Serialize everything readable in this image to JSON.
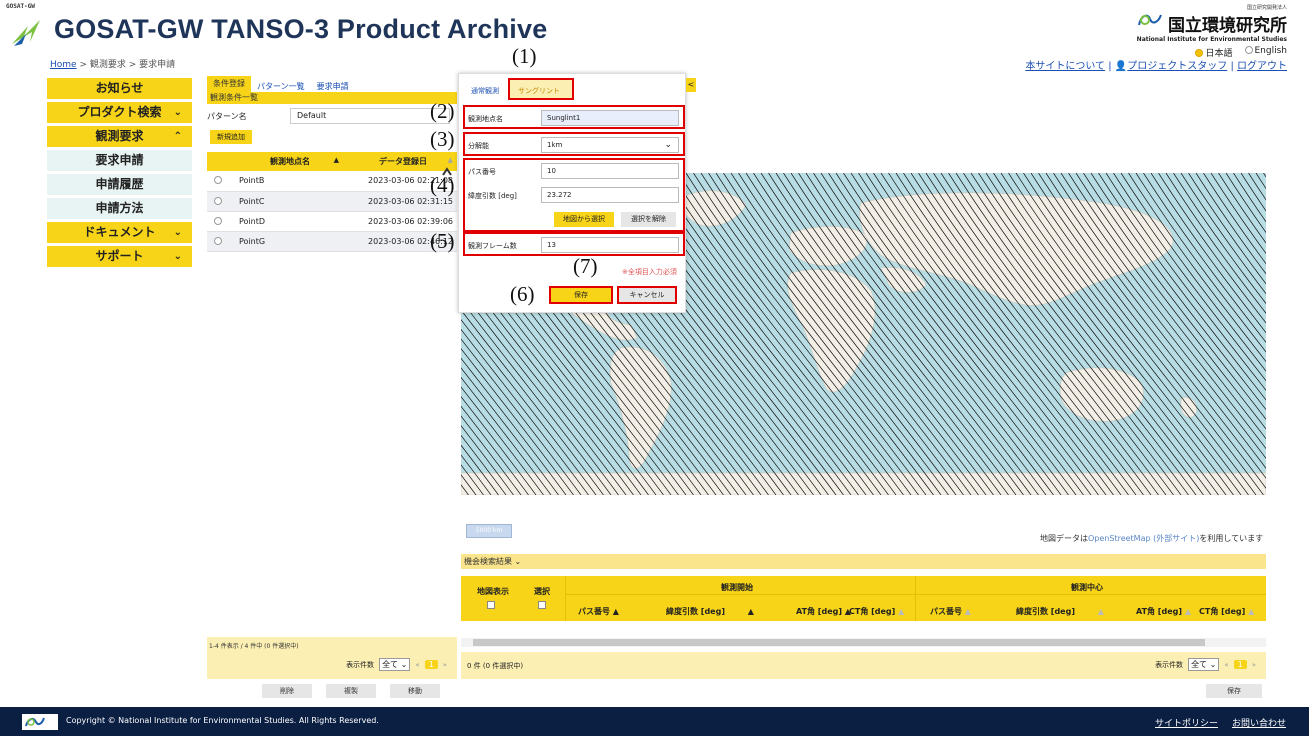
{
  "header": {
    "gw_tag": "GOSAT-GW",
    "title": "GOSAT-GW TANSO-3 Product Archive",
    "breadcrumb": {
      "home": "Home",
      "sep1": " > ",
      "middle": "観測要求",
      "sep2": " > ",
      "current": "要求申請"
    },
    "institute": {
      "small": "国立研究開発法人",
      "name_jp": "国立環境研究所",
      "name_en": "National Institute for Environmental Studies"
    },
    "languages": [
      {
        "label": "日本語",
        "selected": true
      },
      {
        "label": "English",
        "selected": false
      }
    ],
    "links": {
      "about": "本サイトについて",
      "sep1": "|",
      "staff": "プロジェクトスタッフ",
      "sep2": "|",
      "logout": "ログアウト"
    }
  },
  "nav": {
    "items": [
      {
        "label": "お知らせ",
        "chevron": ""
      },
      {
        "label": "プロダクト検索",
        "chevron": "⌄"
      },
      {
        "label": "観測要求",
        "chevron": "⌃"
      }
    ],
    "subitems": [
      "要求申請",
      "申請履歴",
      "申請方法"
    ],
    "items2": [
      {
        "label": "ドキュメント",
        "chevron": "⌄"
      },
      {
        "label": "サポート",
        "chevron": "⌄"
      }
    ]
  },
  "left_panel": {
    "tabs": [
      "条件登録",
      "パターン一覧",
      "要求申請"
    ],
    "section_title": "観測条件一覧",
    "pattern_label": "パターン名",
    "pattern_value": "Default",
    "new_button": "新規追加",
    "columns": [
      "観測地点名",
      "データ登録日"
    ],
    "rows": [
      {
        "name": "PointB",
        "date": "2023-03-06 02:21:08"
      },
      {
        "name": "PointC",
        "date": "2023-03-06 02:31:15"
      },
      {
        "name": "PointD",
        "date": "2023-03-06 02:39:06"
      },
      {
        "name": "PointG",
        "date": "2023-03-06 02:46:12"
      }
    ],
    "count_text": "1-4 件表示 / 4 件中 (0 件選択中)",
    "per_page_label": "表示件数",
    "per_page_value": "全て ⌄",
    "page": "1",
    "buttons": [
      "削除",
      "複製",
      "移動"
    ]
  },
  "dialog": {
    "tabs": [
      "通常観測",
      "サングリント"
    ],
    "site_label": "観測地点名",
    "site_value": "Sunglint1",
    "res_label": "分解能",
    "res_value": "1km",
    "path_label": "パス番号",
    "path_value": "10",
    "lat_label": "緯度引数 [deg]",
    "lat_value": "23.272",
    "map_select": "地図から選択",
    "clear_select": "選択を解除",
    "frames_label": "観測フレーム数",
    "frames_value": "13",
    "required_note": "※全項目入力必須",
    "save": "保存",
    "cancel": "キャンセル",
    "collapse": "<"
  },
  "annotations": [
    "(1)",
    "(2)",
    "(3)",
    "(4)",
    "(5)",
    "(6)",
    "(7)"
  ],
  "map": {
    "scale": "5000 km",
    "credit_pre": "地図データは",
    "credit_link": "OpenStreetMap (外部サイト)",
    "credit_post": "を利用しています"
  },
  "results": {
    "title": "機会検索結果 ⌄",
    "col_map": "地図表示",
    "col_select": "選択",
    "group1": "観測開始",
    "group2": "観測中心",
    "cols": [
      "パス番号",
      "緯度引数 [deg]",
      "AT角 [deg]",
      "CT角 [deg]",
      "パス番号",
      "緯度引数 [deg]",
      "AT角 [deg]",
      "CT角 [deg]"
    ],
    "count": "0 件 (0 件選択中)",
    "per_page_label": "表示件数",
    "per_page_value": "全て ⌄",
    "page": "1",
    "save": "保存"
  },
  "footer": {
    "copyright": "Copyright © National Institute for Environmental Studies. All Rights Reserved.",
    "policy": "サイトポリシー",
    "contact": "お問い合わせ"
  },
  "colors": {
    "accent_yellow": "#f7d417",
    "footer_navy": "#0b1f43",
    "title_navy": "#1e3559",
    "map_sea": "#b9dde4",
    "highlight_red": "#e00000"
  }
}
